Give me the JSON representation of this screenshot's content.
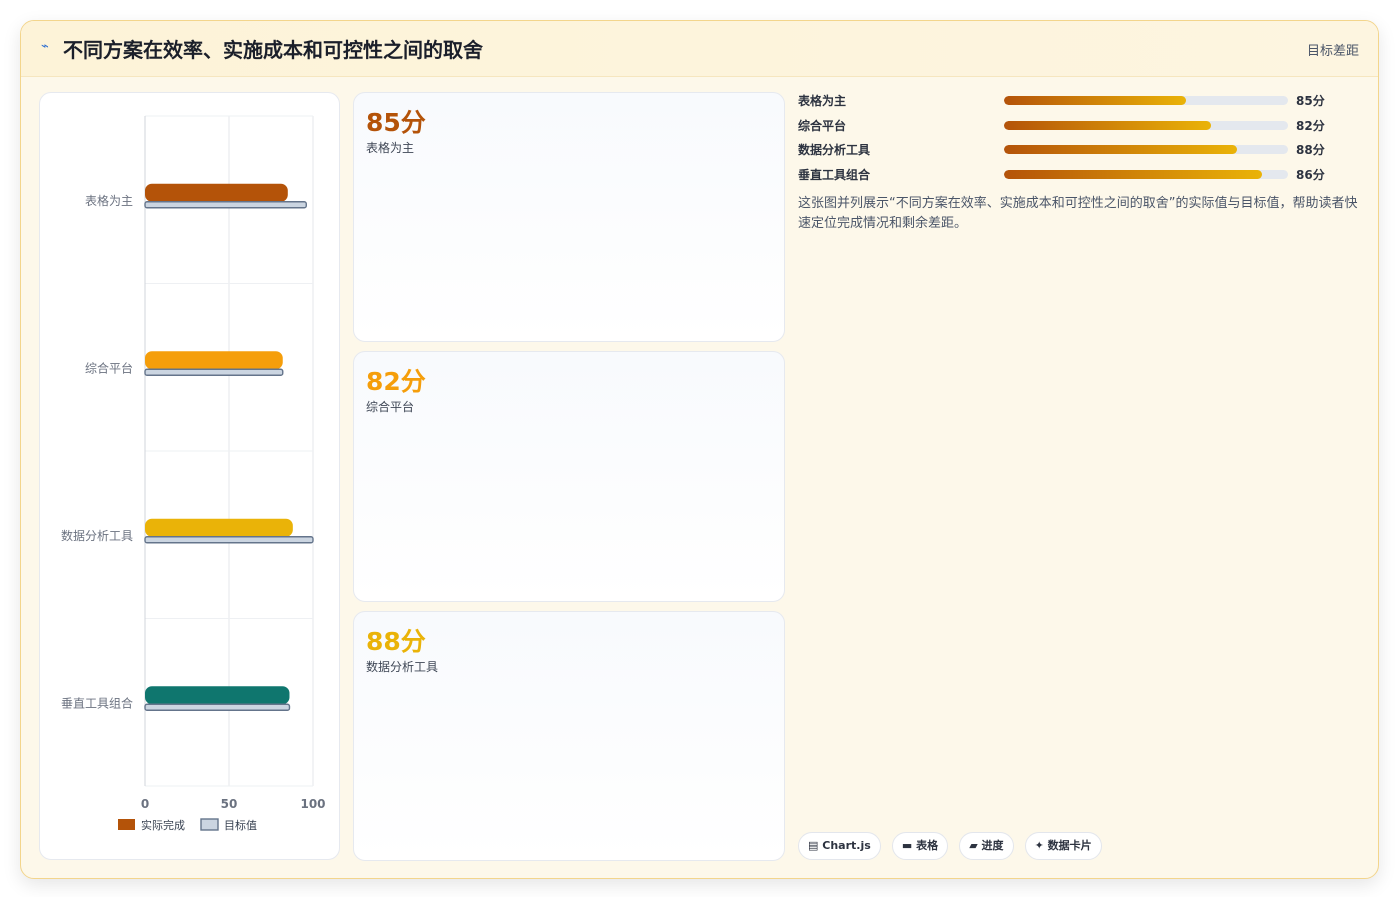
{
  "header": {
    "icon": "trend-icon",
    "title": "不同方案在效率、实施成本和可控性之间的取舍",
    "right_label": "目标差距"
  },
  "chart_data": {
    "type": "bar",
    "orientation": "horizontal",
    "categories": [
      "表格为主",
      "综合平台",
      "数据分析工具",
      "垂直工具组合"
    ],
    "series": [
      {
        "name": "实际完成",
        "values": [
          85,
          82,
          88,
          86
        ],
        "colors": [
          "#b45309",
          "#f59e0b",
          "#eab308",
          "#0f766e"
        ]
      },
      {
        "name": "目标值",
        "values": [
          96,
          82,
          100,
          86
        ],
        "color": "#cbd5e1"
      }
    ],
    "xlim": [
      0,
      100
    ],
    "x_ticks": [
      "0",
      "50",
      "100"
    ],
    "grid": true,
    "legend": "bottom"
  },
  "kpi_cards": [
    {
      "value": "85分",
      "label": "表格为主",
      "color": "#b45309"
    },
    {
      "value": "82分",
      "label": "综合平台",
      "color": "#f59e0b"
    },
    {
      "value": "88分",
      "label": "数据分析工具",
      "color": "#eab308"
    }
  ],
  "progress": [
    {
      "label": "表格为主",
      "value_text": "85分",
      "fraction": 0.64
    },
    {
      "label": "综合平台",
      "value_text": "82分",
      "fraction": 0.73
    },
    {
      "label": "数据分析工具",
      "value_text": "88分",
      "fraction": 0.82
    },
    {
      "label": "垂直工具组合",
      "value_text": "86分",
      "fraction": 0.91
    }
  ],
  "description": "这张图并列展示“不同方案在效率、实施成本和可控性之间的取舍”的实际值与目标值，帮助读者快速定位完成情况和剩余差距。",
  "tags": [
    {
      "icon": "chart-icon",
      "label": "Chart.js"
    },
    {
      "icon": "table-icon",
      "label": "表格"
    },
    {
      "icon": "progress-icon",
      "label": "进度"
    },
    {
      "icon": "sparkle-icon",
      "label": "数据卡片"
    }
  ]
}
